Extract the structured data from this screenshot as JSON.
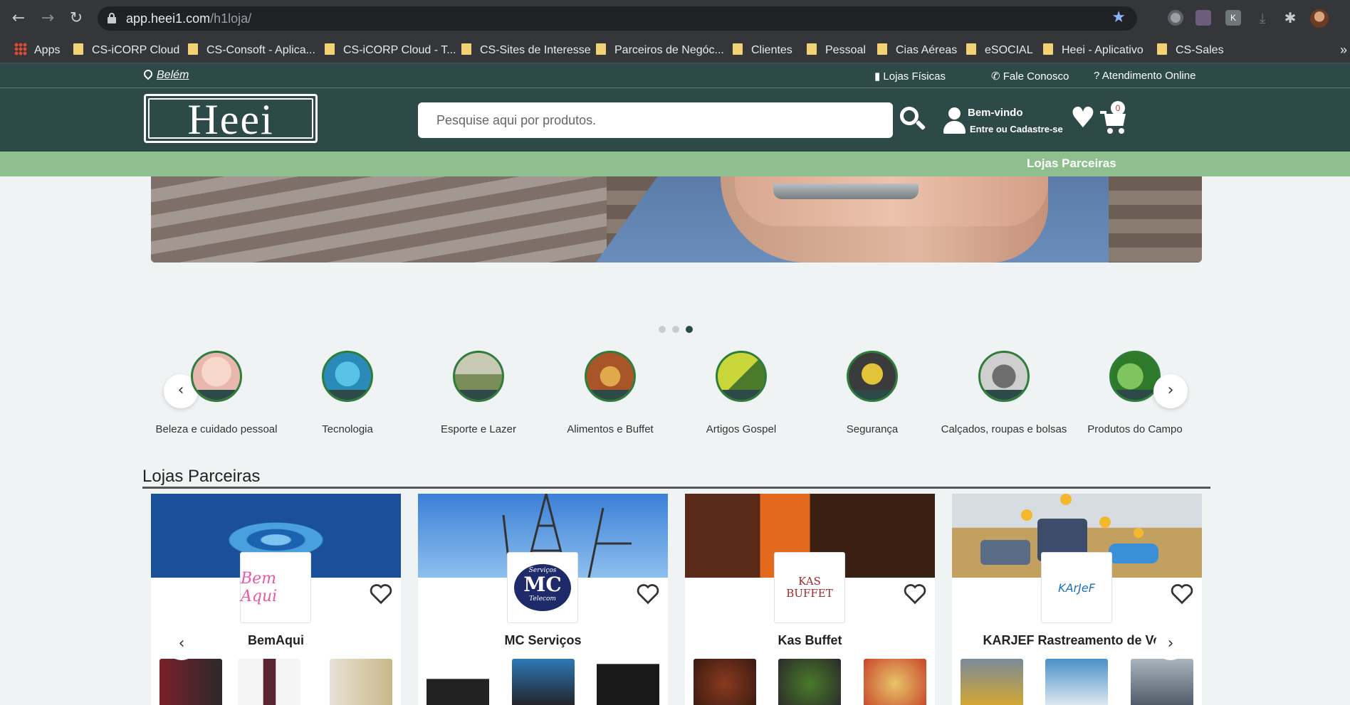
{
  "browser": {
    "url_host": "app.heei1.com",
    "url_path": "/h1loja/",
    "bookmarks": [
      {
        "label": "Apps"
      },
      {
        "label": "CS-iCORP Cloud"
      },
      {
        "label": "CS-Consoft - Aplica..."
      },
      {
        "label": "CS-iCORP Cloud - T..."
      },
      {
        "label": "CS-Sites de Interesse"
      },
      {
        "label": "Parceiros de Negóc..."
      },
      {
        "label": "Clientes"
      },
      {
        "label": "Pessoal"
      },
      {
        "label": "Cias Aéreas"
      },
      {
        "label": "eSOCIAL"
      },
      {
        "label": "Heei - Aplicativo"
      },
      {
        "label": "CS-Sales"
      }
    ],
    "more_bookmarks": "»"
  },
  "topbar": {
    "city": "Belém",
    "links": [
      {
        "label": "Lojas Físicas"
      },
      {
        "label": "Fale Conosco"
      },
      {
        "label": "Atendimento Online"
      }
    ]
  },
  "header": {
    "logo_text": "Heei",
    "search_placeholder": "Pesquise aqui por produtos.",
    "welcome": "Bem-vindo",
    "signin": "Entre ou Cadastre-se",
    "cart_count": "0",
    "partners_link": "Lojas Parceiras"
  },
  "carousel": {
    "slide_count": 3,
    "active_slide": 3
  },
  "categories": [
    {
      "label": "Beleza e cuidado pessoal",
      "icon": "beauty-icon",
      "color": "#f1d7cf"
    },
    {
      "label": "Tecnologia",
      "icon": "technology-icon",
      "color": "#2fa0c9"
    },
    {
      "label": "Esporte e Lazer",
      "icon": "sports-icon",
      "color": "#a7a98d"
    },
    {
      "label": "Alimentos e Buffet",
      "icon": "food-icon",
      "color": "#c57a3c"
    },
    {
      "label": "Artigos Gospel",
      "icon": "gospel-icon",
      "color": "#9bbd2d"
    },
    {
      "label": "Segurança",
      "icon": "security-icon",
      "color": "#c9b23a"
    },
    {
      "label": "Calçados, roupas e bolsas",
      "icon": "shoes-icon",
      "color": "#4a4a4a"
    },
    {
      "label": "Produtos do Campo",
      "icon": "farm-icon",
      "color": "#3f8f3a"
    }
  ],
  "stores_section": {
    "title": "Lojas Parceiras",
    "stores": [
      {
        "name": "BemAqui",
        "logo_text": "Bem Aqui",
        "logo_color": "#e85aa8"
      },
      {
        "name": "MC Serviços",
        "logo_text": "MC",
        "logo_top": "Serviços",
        "logo_bottom": "Telecom",
        "logo_color": "#1f2a6b"
      },
      {
        "name": "Kas Buffet",
        "logo_text": "KAS BUFFET",
        "logo_color": "#a0282c"
      },
      {
        "name": "KARJEF Rastreamento de Veíc",
        "logo_text": "KArJeF",
        "logo_color": "#1f6fbf"
      }
    ]
  }
}
